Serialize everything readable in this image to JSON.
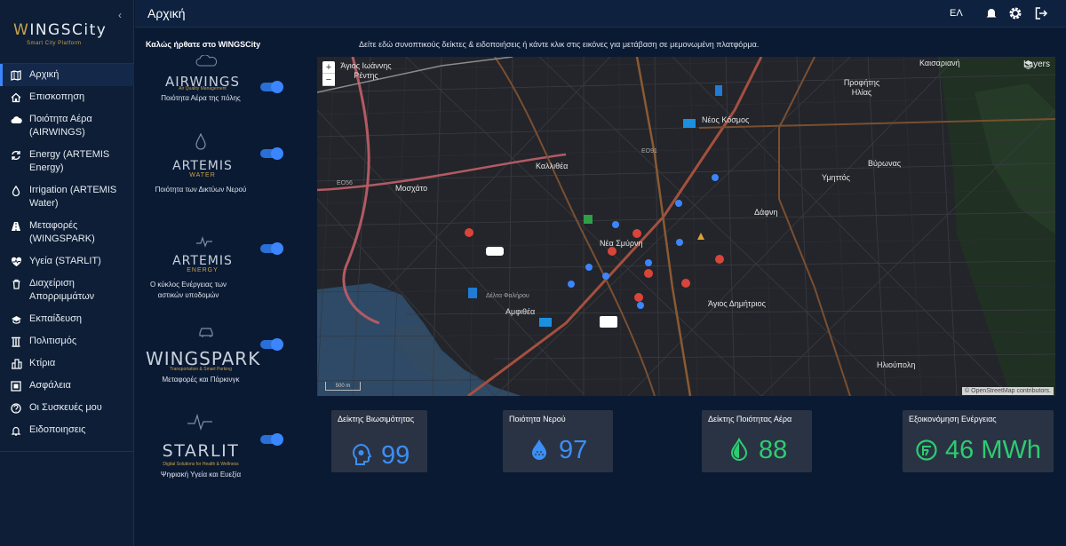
{
  "app": {
    "logo_main_1": "W",
    "logo_main_2": "INGSCity",
    "logo_sub": "Smart City Platform"
  },
  "sidebar": {
    "items": [
      {
        "label": "Αρχική",
        "icon": "map-icon",
        "active": true
      },
      {
        "label": "Επισκοπηση",
        "icon": "home-icon"
      },
      {
        "label": "Ποιότητα Αέρα (AIRWINGS)",
        "icon": "cloud-icon"
      },
      {
        "label": "Energy (ARTEMIS Energy)",
        "icon": "refresh-icon"
      },
      {
        "label": "Irrigation (ARTEMIS Water)",
        "icon": "drop-icon"
      },
      {
        "label": "Μεταφορές (WINGSPARK)",
        "icon": "road-icon"
      },
      {
        "label": "Υγεία (STARLIT)",
        "icon": "heart-pulse-icon"
      },
      {
        "label": "Διαχείριση Απορριμμάτων",
        "icon": "trash-icon"
      },
      {
        "label": "Εκπαίδευση",
        "icon": "graduation-icon"
      },
      {
        "label": "Πολιτισμός",
        "icon": "columns-icon"
      },
      {
        "label": "Κτίρια",
        "icon": "buildings-icon"
      },
      {
        "label": "Ασφάλεια",
        "icon": "shield-grid-icon"
      },
      {
        "label": "Οι Συσκευές μου",
        "icon": "device-icon"
      },
      {
        "label": "Ειδοποιησεις",
        "icon": "bell-icon"
      }
    ]
  },
  "topbar": {
    "title": "Αρχική",
    "language": "ΕΛ"
  },
  "content": {
    "welcome": "Καλώς ήρθατε στο WINGSCity",
    "intro": "Δείτε εδώ συνοπτικούς δείκτες & ειδοποιήσεις ή κάντε κλικ στις εικόνες για μετάβαση σε μεμονωμένη πλατφόρμα."
  },
  "platforms": [
    {
      "logo": "AIRWINGS",
      "logo_sub": "Air Quality Management",
      "caption": "Ποιότητα Αέρα της πόλης",
      "enabled": true
    },
    {
      "logo": "ARTEMIS",
      "logo_sub": "WATER",
      "caption": "Ποιότητα των Δικτύων Νερού",
      "enabled": true
    },
    {
      "logo": "ARTEMIS",
      "logo_sub": "ENERGY",
      "caption": "Ο κύκλος Ενέργειας των αστικών υποδομών",
      "enabled": true
    },
    {
      "logo": "WINGSPARK",
      "logo_sub": "Transportation & Smart Parking",
      "caption": "Μεταφορές και Πάρκινγκ",
      "enabled": true
    },
    {
      "logo": "STARLIT",
      "logo_sub": "Digital Solutions for Health & Wellness",
      "caption": "Ψηφιακή Υγεία και Ευεξία",
      "enabled": true
    }
  ],
  "map": {
    "layers_label": "Layers",
    "zoom_in": "+",
    "zoom_out": "−",
    "attribution": "© OpenStreetMap contributors.",
    "scale": "500 m",
    "labels": {
      "l1": "Άγιος Ιωάννης Ρέντης",
      "l2": "Καλλιθέα",
      "l3": "Μοσχάτο",
      "l4": "Νέα Σμύρνη",
      "l5": "Αμφιθέα",
      "l6": "Νέος Κόσμος",
      "l7": "Βύρωνας",
      "l8": "Υμηττός",
      "l9": "Δάφνη",
      "l10": "Άγιος Δημήτριος",
      "l11": "Ηλιούπολη",
      "l12": "Καισαριανή",
      "l13": "Προφήτης Ηλίας",
      "l14": "Δέλτα Φαλήρου",
      "l15": "ΕΟ91",
      "l16": "ΕΟ56"
    }
  },
  "kpis": [
    {
      "title": "Δείκτης Βιωσιμότητας",
      "value": "99",
      "icon": "head-icon",
      "color": "#3b8ff5"
    },
    {
      "title": "Ποιότητα Νερού",
      "value": "97",
      "icon": "water-drop-icon",
      "color": "#3b8ff5"
    },
    {
      "title": "Δείκτης Ποιότητας Αέρα",
      "value": "88",
      "icon": "leaf-drop-icon",
      "color": "#2ecc71"
    },
    {
      "title": "Εξοικονόμηση Ενέργειας",
      "value": "46 MWh",
      "icon": "energy-saving-icon",
      "color": "#2ecc71"
    }
  ]
}
